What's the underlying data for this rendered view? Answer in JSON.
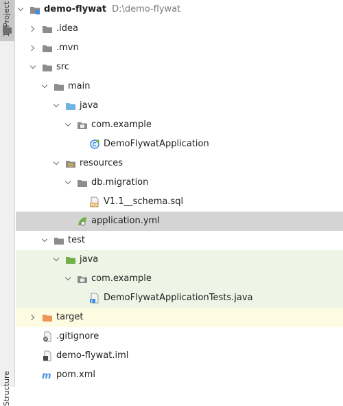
{
  "sidebar": {
    "project_tab_label": "1: Project",
    "structure_tab_label": "Structure"
  },
  "tree": {
    "root": {
      "label": "demo-flywat",
      "path": "D:\\demo-flywat"
    },
    "idea": "idea",
    "mvn": "mvn",
    "src": "src",
    "main": "main",
    "main_java": "java",
    "main_pkg": "com.example",
    "app_class": "DemoFlywatApplication",
    "resources": "resources",
    "db_migration": "db.migration",
    "sql_file": "V1.1__schema.sql",
    "app_yml": "application.yml",
    "test": "test",
    "test_java": "java",
    "test_pkg": "com.example",
    "test_class": "DemoFlywatApplicationTests.java",
    "target": "target",
    "gitignore": ".gitignore",
    "iml": "demo-flywat.iml",
    "pom": "pom.xml"
  },
  "colors": {
    "selected_row": "#d4d4d4",
    "test_row": "#eef5e6",
    "excluded_row": "#fdfbe2",
    "folder": "#8c8c8c",
    "source_folder": "#6fb3e0",
    "test_folder": "#72b04a",
    "excluded_folder": "#f0955a"
  }
}
